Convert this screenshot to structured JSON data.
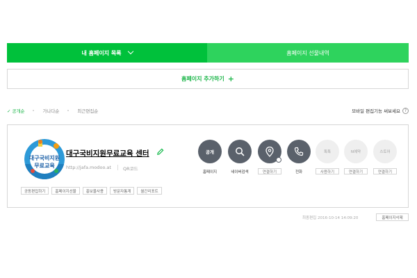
{
  "tabs": {
    "my_pages_label": "내 홈페이지 목록",
    "gift_history_label": "홈페이지 선물내역"
  },
  "add_page": {
    "label": "홈페이지 추가하기",
    "plus": "+"
  },
  "sort": {
    "items": [
      {
        "label": "✓ 공개순",
        "active": true
      },
      {
        "label": "가나다순",
        "active": false
      },
      {
        "label": "최근편집순",
        "active": false
      }
    ]
  },
  "mobile_tip": {
    "label": "모바일 편집기능 써보세요",
    "help": "?"
  },
  "site": {
    "title": "대구국비지원무료교육 센터",
    "url": "http://jafa.modoo.at",
    "qr_label": "QR코드",
    "thumb_text_line1": "대구국비지원",
    "thumb_text_line2": "무료교육"
  },
  "tags": [
    "공동편집하기",
    "홈페이지선물",
    "홍보물사용",
    "방문자통계",
    "월간리포트"
  ],
  "actions": [
    {
      "icon_text": "공개",
      "label": "홈페이지",
      "style": "dark",
      "label_style": "plain"
    },
    {
      "icon": "search-icon",
      "label": "네이버검색",
      "style": "dark",
      "label_style": "plain"
    },
    {
      "icon": "location-pin-icon",
      "label": "연결하기",
      "style": "dark",
      "label_style": "box"
    },
    {
      "icon": "phone-icon",
      "label": "전화",
      "style": "dark",
      "label_style": "plain"
    },
    {
      "icon_text": "톡톡",
      "label": "사용하기",
      "style": "light",
      "label_style": "box"
    },
    {
      "icon_text": "N예약",
      "label": "연결하기",
      "style": "light",
      "label_style": "box"
    },
    {
      "icon_text": "스토어",
      "label": "연결하기",
      "style": "light",
      "label_style": "box"
    }
  ],
  "footer": {
    "created_date": "최종편집 2016-10-14 14:09:20",
    "delete_label": "홈페이지삭제"
  },
  "colors": {
    "brand_green": "#00c13b",
    "brand_green_light": "#2ed35d",
    "text_green": "#1db64a",
    "action_dark": "#5a616b"
  }
}
